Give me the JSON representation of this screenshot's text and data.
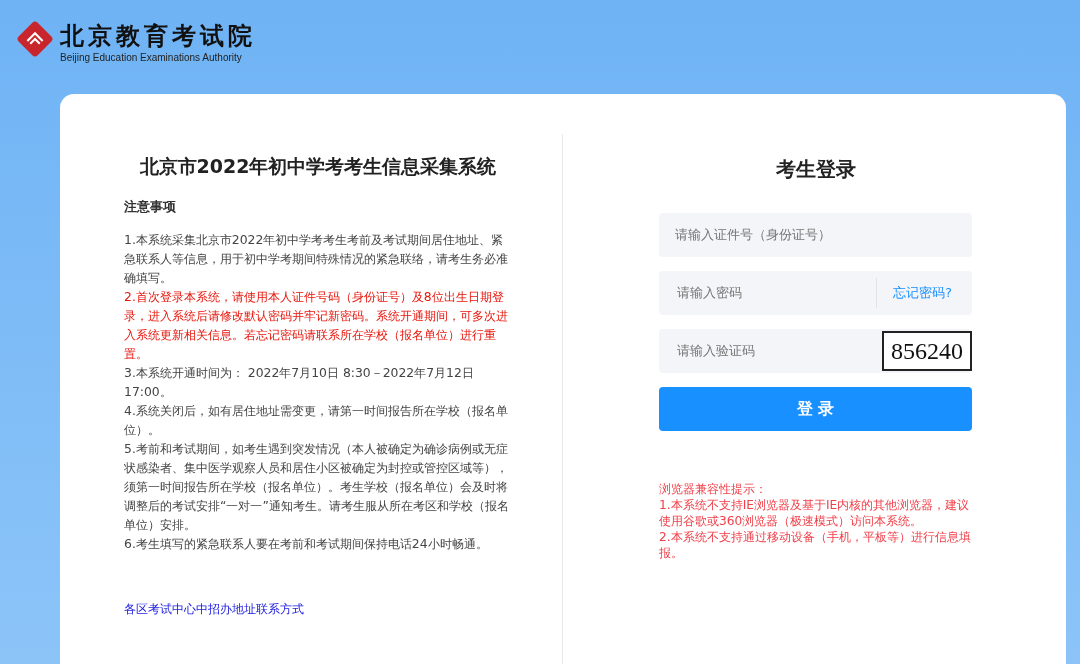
{
  "header": {
    "logo_title": "北京教育考试院",
    "logo_subtitle": "Beijing Education Examinations Authority"
  },
  "notice_panel": {
    "title": "北京市2022年初中学考考生信息采集系统",
    "heading": "注意事项",
    "items": [
      {
        "kind": "normal",
        "text": "1.本系统采集北京市2022年初中学考考生考前及考试期间居住地址、紧急联系人等信息，用于初中学考期间特殊情况的紧急联络，请考生务必准确填写。"
      },
      {
        "kind": "warning",
        "text": "2.首次登录本系统，请使用本人证件号码（身份证号）及8位出生日期登录，进入系统后请修改默认密码并牢记新密码。系统开通期间，可多次进入系统更新相关信息。若忘记密码请联系所在学校（报名单位）进行重置。"
      },
      {
        "kind": "normal",
        "text": "3.本系统开通时间为： 2022年7月10日  8:30－2022年7月12日 17:00。"
      },
      {
        "kind": "normal",
        "text": "4.系统关闭后，如有居住地址需变更，请第一时间报告所在学校（报名单位）。"
      },
      {
        "kind": "normal",
        "text": "5.考前和考试期间，如考生遇到突发情况（本人被确定为确诊病例或无症状感染者、集中医学观察人员和居住小区被确定为封控或管控区域等），须第一时间报告所在学校（报名单位）。考生学校（报名单位）会及时将调整后的考试安排“一对一”通知考生。请考生服从所在考区和学校（报名单位）安排。"
      },
      {
        "kind": "normal",
        "text": "6.考生填写的紧急联系人要在考前和考试期间保持电话24小时畅通。"
      }
    ],
    "link": "各区考试中心中招办地址联系方式"
  },
  "login": {
    "title": "考生登录",
    "id_field": {
      "placeholder": "请输入证件号（身份证号）"
    },
    "password_field": {
      "placeholder": "请输入密码"
    },
    "forgot_link": "忘记密码?",
    "captcha_field": {
      "placeholder": "请输入验证码"
    },
    "captcha_text": "856240",
    "submit_button": "登 录",
    "compat_title": "浏览器兼容性提示：",
    "compat_items": [
      "1.本系统不支持IE浏览器及基于IE内核的其他浏览器，建议使用谷歌或360浏览器（极速模式）访问本系统。",
      "2.本系统不支持通过移动设备（手机，平板等）进行信息填报。"
    ]
  }
}
